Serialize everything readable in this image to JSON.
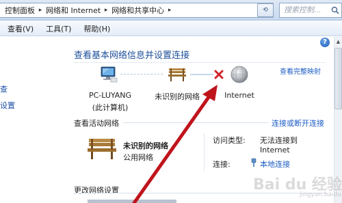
{
  "address_bar": {
    "crumbs": [
      "控制面板",
      "网络和 Internet",
      "网络和共享中心"
    ],
    "search_placeholder": "搜索控制..."
  },
  "menu": [
    "查看(V)",
    "工具(T)",
    "帮助(H)"
  ],
  "left_nav": [
    "查",
    "设置"
  ],
  "main": {
    "title": "查看基本网络信息并设置连接",
    "full_map_link": "查看完整映射",
    "nodes": {
      "pc_name": "PC-LUYANG",
      "pc_sub": "(此计算机)",
      "network": "未识别的网络",
      "internet": "Internet"
    },
    "active_section": "查看活动网络",
    "connect_link": "连接或断开连接",
    "active_network": {
      "name": "未识别的网络",
      "type": "公用网络",
      "access_label": "访问类型:",
      "access_value_1": "无法连接到",
      "access_value_2": "Internet",
      "conn_label": "连接:",
      "conn_value": "本地连接"
    },
    "change_section": "更改网络设置"
  },
  "help": "?",
  "colors": {
    "link": "#1c5cc4",
    "title": "#1d4f9a",
    "arrow": "#c0141c",
    "x_mark": "#d0232a"
  },
  "icons": [
    "search-icon",
    "refresh-icon",
    "help-icon",
    "computer-icon",
    "bench-icon",
    "globe-icon",
    "x-mark-icon",
    "connection-icon"
  ]
}
